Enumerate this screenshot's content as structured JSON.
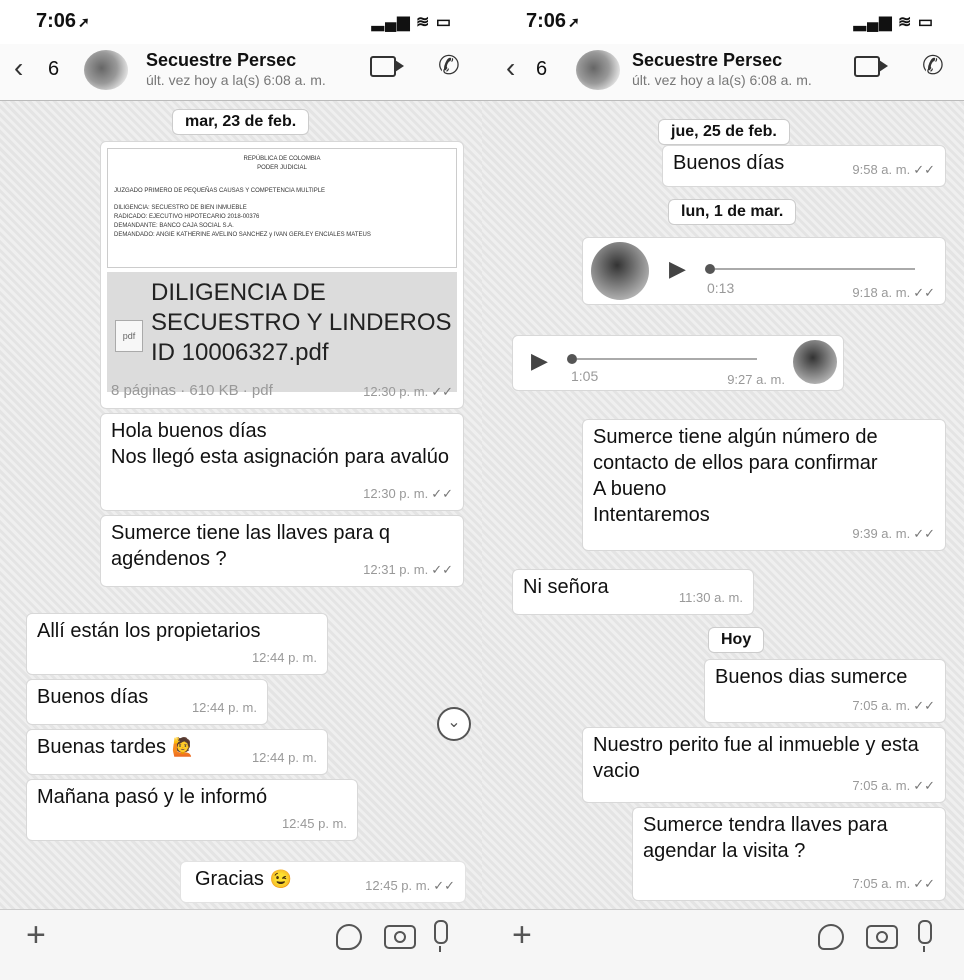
{
  "status": {
    "time": "7:06",
    "time_arrow": "➚",
    "icons": "▂▄▆ ≋ ▭"
  },
  "header": {
    "back_glyph": "‹",
    "back_count": "6",
    "contact_name": "Secuestre Persec",
    "last_seen": "últ. vez hoy a la(s) 6:08 a. m."
  },
  "left": {
    "date_1": "mar, 23 de feb.",
    "document": {
      "preview_lines": [
        "REPÚBLICA DE COLOMBIA",
        "PODER JUDICIAL",
        "JUZGADO PRIMERO DE PEQUEÑAS CAUSAS Y COMPETENCIA MULTIPLE",
        "DILIGENCIA: SECUESTRO DE BIEN INMUEBLE",
        "RADICADO: EJECUTIVO HIPOTECARIO 2018-00376",
        "DEMANDANTE: BANCO CAJA SOCIAL S.A.",
        "DEMANDADO: ANGIE KATHERINE AVELINO SANCHEZ y IVAN GERLEY ENCIALES MATEUS"
      ],
      "pdf_label": "pdf",
      "filename": "DILIGENCIA DE SECUESTRO Y LINDEROS ID 10006327.pdf",
      "pages_info": "8 páginas · 610 KB · pdf",
      "time": "12:30 p. m."
    },
    "messages": [
      {
        "text": "Hola buenos días\nNos llegó esta asignación para avalúo",
        "time": "12:30 p. m.",
        "outgoing": true
      },
      {
        "text": "Sumerce tiene las llaves para q agéndenos ?",
        "time": "12:31 p. m.",
        "outgoing": true
      },
      {
        "text": "Allí están los propietarios",
        "time": "12:44 p. m.",
        "outgoing": false
      },
      {
        "text": "Buenos días",
        "time": "12:44 p. m.",
        "outgoing": false
      },
      {
        "text": "Buenas tardes",
        "emoji": "🙋",
        "time": "12:44 p. m.",
        "outgoing": false
      },
      {
        "text": "Mañana pasó y le informó",
        "time": "12:45 p. m.",
        "outgoing": false
      },
      {
        "text": "Gracias",
        "emoji": "😉",
        "time": "12:45 p. m.",
        "outgoing": true
      }
    ],
    "scroll_down_glyph": "⌄"
  },
  "right": {
    "date_1": "jue, 25 de feb.",
    "msg_1": {
      "text": "Buenos días",
      "time": "9:58 a. m."
    },
    "date_2": "lun, 1 de mar.",
    "voice_1": {
      "duration": "0:13",
      "time": "9:18 a. m."
    },
    "voice_2": {
      "duration": "1:05",
      "time": "9:27 a. m."
    },
    "messages": [
      {
        "text": "Sumerce tiene algún número de contacto de ellos para confirmar\nA bueno\nIntentaremos",
        "time": "9:39 a. m.",
        "outgoing": true
      },
      {
        "text": "Ni señora",
        "time": "11:30 a. m.",
        "outgoing": false
      }
    ],
    "date_3": "Hoy",
    "today_messages": [
      {
        "text": "Buenos dias sumerce",
        "time": "7:05 a. m."
      },
      {
        "text": "Nuestro perito fue al inmueble y esta vacio",
        "time": "7:05 a. m."
      },
      {
        "text": "Sumerce tendra llaves para agendar la visita ?",
        "time": "7:05 a. m."
      }
    ]
  },
  "ticks": "✓✓",
  "play_glyph": "▶",
  "composer": {
    "plus_glyph": "+"
  },
  "icons": [
    "video-call-icon",
    "phone-call-icon",
    "sticker-icon",
    "camera-icon",
    "microphone-icon",
    "plus-icon",
    "back-chevron-icon",
    "play-icon",
    "scroll-down-icon",
    "pdf-icon"
  ]
}
